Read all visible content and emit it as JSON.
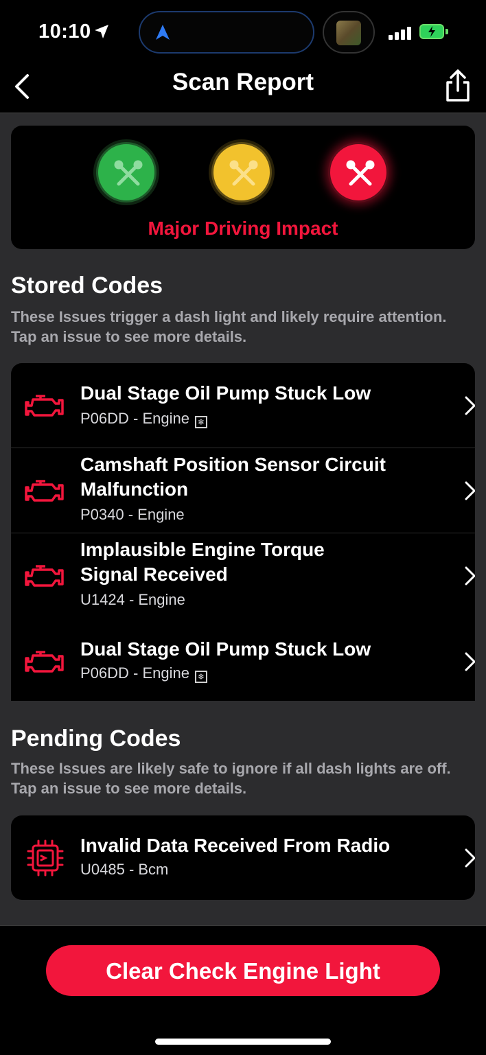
{
  "status_bar": {
    "time": "10:10",
    "icons": [
      "location-arrow-icon",
      "navigation-icon",
      "signal-icon",
      "battery-charging-icon"
    ],
    "battery_color": "#2fd25a"
  },
  "nav": {
    "title": "Scan Report",
    "back_icon": "chevron-left-icon",
    "share_icon": "share-icon"
  },
  "impact": {
    "levels": [
      "green",
      "yellow",
      "red"
    ],
    "active_level": "red",
    "label": "Major Driving Impact",
    "colors": {
      "green": "#2db24a",
      "yellow": "#f2c22d",
      "red": "#f2163c"
    }
  },
  "stored": {
    "title": "Stored Codes",
    "description": "These Issues trigger a dash light and likely require attention. Tap an issue to see more details.",
    "items": [
      {
        "title": "Dual Stage Oil Pump Stuck Low",
        "subtitle": "P06DD - Engine",
        "freeze_frame": true,
        "icon": "check-engine-icon"
      },
      {
        "title": "Camshaft Position Sensor Circuit Malfunction",
        "subtitle": "P0340 - Engine",
        "freeze_frame": false,
        "icon": "check-engine-icon"
      },
      {
        "title": "Implausible Engine Torque Signal Received",
        "subtitle": "U1424 - Engine",
        "freeze_frame": false,
        "icon": "check-engine-icon"
      },
      {
        "title": "Dual Stage Oil Pump Stuck Low",
        "subtitle": "P06DD - Engine",
        "freeze_frame": true,
        "icon": "check-engine-icon"
      }
    ]
  },
  "pending": {
    "title": "Pending Codes",
    "description": "These Issues are likely safe to ignore if all dash lights are off. Tap an issue to see more details.",
    "items": [
      {
        "title": "Invalid Data Received From Radio",
        "subtitle": "U0485 - Bcm",
        "freeze_frame": false,
        "icon": "chip-icon"
      }
    ]
  },
  "actions": {
    "clear_label": "Clear Check Engine Light",
    "accent": "#f2163c"
  }
}
